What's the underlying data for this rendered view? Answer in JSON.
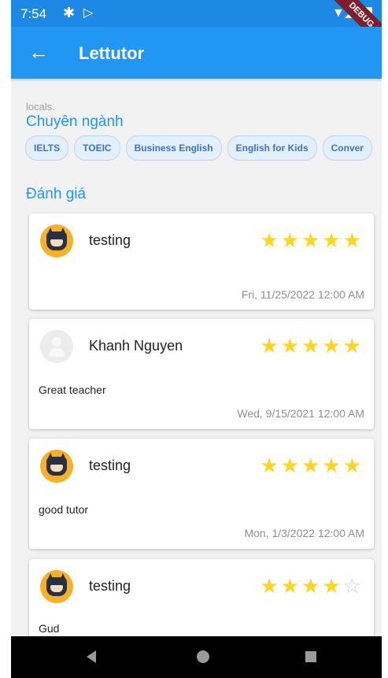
{
  "status_bar": {
    "time": "7:54",
    "debug_label": "DEBUG"
  },
  "app_bar": {
    "title": "Lettutor"
  },
  "partial_text": "locals.",
  "specialties": {
    "title": "Chuyên ngành",
    "chips": [
      "IELTS",
      "TOEIC",
      "Business English",
      "English for Kids",
      "Conver"
    ]
  },
  "reviews": {
    "title": "Đánh giá",
    "items": [
      {
        "name": "testing",
        "rating": 5,
        "comment": "",
        "date": "Fri, 11/25/2022 12:00 AM",
        "avatar": "batman"
      },
      {
        "name": "Khanh Nguyen",
        "rating": 5,
        "comment": "Great teacher",
        "date": "Wed, 9/15/2021 12:00 AM",
        "avatar": "default"
      },
      {
        "name": "testing",
        "rating": 5,
        "comment": "good tutor",
        "date": "Mon, 1/3/2022 12:00 AM",
        "avatar": "batman"
      },
      {
        "name": "testing",
        "rating": 4,
        "comment": "Gud",
        "date": "",
        "avatar": "batman"
      }
    ]
  },
  "colors": {
    "primary": "#2196f3",
    "status_bar": "#1e88e5",
    "star": "#ffd523",
    "chip_bg": "#e3f0fc"
  }
}
